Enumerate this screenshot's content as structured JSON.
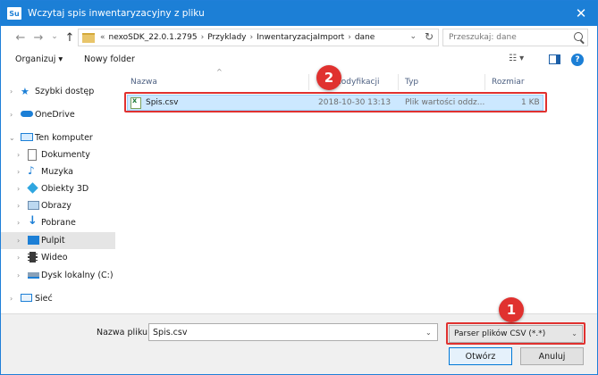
{
  "window": {
    "app_icon_text": "Su",
    "title": "Wczytaj spis inwentaryzacyjny z pliku",
    "close_glyph": "✕"
  },
  "navigation": {
    "back_glyph": "←",
    "forward_glyph": "→",
    "recent_glyph": "⌄",
    "up_glyph": "↑"
  },
  "address": {
    "overflow": "«",
    "crumbs": [
      "nexoSDK_22.0.1.2795",
      "Przyklady",
      "InwentaryzacjaImport",
      "dane"
    ],
    "separator": "›",
    "dropdown_glyph": "⌄",
    "refresh_glyph": "↻"
  },
  "search": {
    "placeholder": "Przeszukaj: dane"
  },
  "toolbar": {
    "organize_label": "Organizuj ▾",
    "new_folder_label": "Nowy folder",
    "view_glyph": "☷ ▾"
  },
  "sidebar": {
    "items": [
      {
        "label": "Szybki dostęp",
        "icon": "star-icon"
      },
      {
        "label": "OneDrive",
        "icon": "cloud-icon"
      },
      {
        "label": "Ten komputer",
        "icon": "computer-icon"
      },
      {
        "label": "Dokumenty",
        "icon": "document-icon"
      },
      {
        "label": "Muzyka",
        "icon": "music-icon"
      },
      {
        "label": "Obiekty 3D",
        "icon": "cube-icon"
      },
      {
        "label": "Obrazy",
        "icon": "image-icon"
      },
      {
        "label": "Pobrane",
        "icon": "download-icon"
      },
      {
        "label": "Pulpit",
        "icon": "desktop-icon"
      },
      {
        "label": "Wideo",
        "icon": "video-icon"
      },
      {
        "label": "Dysk lokalny (C:)",
        "icon": "drive-icon"
      },
      {
        "label": "Sieć",
        "icon": "network-icon"
      }
    ]
  },
  "file_list": {
    "columns": {
      "name": "Nazwa",
      "modified": "modyfikacji",
      "type": "Typ",
      "size": "Rozmiar"
    },
    "rows": [
      {
        "name": "Spis.csv",
        "modified": "2018-10-30 13:13",
        "type": "Plik wartości oddz...",
        "size": "1 KB"
      }
    ]
  },
  "annotations": {
    "badge_1": "1",
    "badge_2": "2"
  },
  "bottom": {
    "filename_label": "Nazwa pliku:",
    "filename_value": "Spis.csv",
    "filetype_value": "Parser plików CSV (*.*)",
    "open_button": "Otwórz",
    "cancel_button": "Anuluj"
  },
  "colors": {
    "titlebar": "#1c7fd6",
    "selection": "#cce8ff",
    "annotation": "#e0312f"
  }
}
